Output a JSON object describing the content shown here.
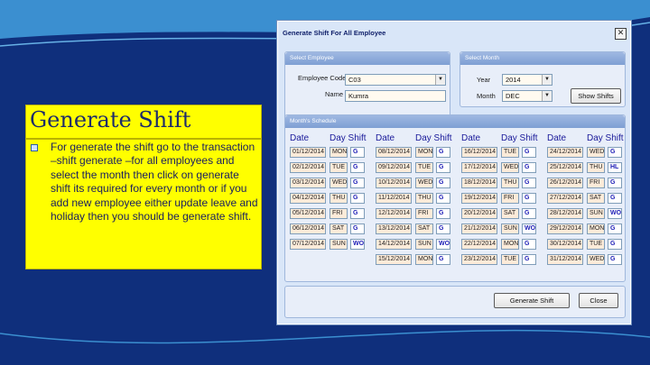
{
  "slide": {
    "title": "Generate Shift",
    "body": "For generate the shift go to the transaction –shift generate –for all employees and select the month then click on generate shift its required for every month or if you add new employee either update leave and holiday then you should be generate shift."
  },
  "dialog": {
    "title": "Generate Shift For All Employee",
    "select_employee": {
      "heading": "Select Employee",
      "code_label": "Employee Code",
      "code_value": "C03",
      "name_label": "Name",
      "name_value": "Kumra"
    },
    "select_month": {
      "heading": "Select Month",
      "year_label": "Year",
      "year_value": "2014",
      "month_label": "Month",
      "month_value": "DEC",
      "show_button": "Show Shifts"
    },
    "schedule": {
      "heading": "Month's Schedule",
      "date_header": "Date",
      "day_shift_header": "Day Shift",
      "columns": [
        [
          {
            "date": "01/12/2014",
            "day": "MON",
            "shift": "G"
          },
          {
            "date": "02/12/2014",
            "day": "TUE",
            "shift": "G"
          },
          {
            "date": "03/12/2014",
            "day": "WED",
            "shift": "G"
          },
          {
            "date": "04/12/2014",
            "day": "THU",
            "shift": "G"
          },
          {
            "date": "05/12/2014",
            "day": "FRI",
            "shift": "G"
          },
          {
            "date": "06/12/2014",
            "day": "SAT",
            "shift": "G"
          },
          {
            "date": "07/12/2014",
            "day": "SUN",
            "shift": "WO"
          }
        ],
        [
          {
            "date": "08/12/2014",
            "day": "MON",
            "shift": "G"
          },
          {
            "date": "09/12/2014",
            "day": "TUE",
            "shift": "G"
          },
          {
            "date": "10/12/2014",
            "day": "WED",
            "shift": "G"
          },
          {
            "date": "11/12/2014",
            "day": "THU",
            "shift": "G"
          },
          {
            "date": "12/12/2014",
            "day": "FRI",
            "shift": "G"
          },
          {
            "date": "13/12/2014",
            "day": "SAT",
            "shift": "G"
          },
          {
            "date": "14/12/2014",
            "day": "SUN",
            "shift": "WO"
          },
          {
            "date": "15/12/2014",
            "day": "MON",
            "shift": "G"
          }
        ],
        [
          {
            "date": "16/12/2014",
            "day": "TUE",
            "shift": "G"
          },
          {
            "date": "17/12/2014",
            "day": "WED",
            "shift": "G"
          },
          {
            "date": "18/12/2014",
            "day": "THU",
            "shift": "G"
          },
          {
            "date": "19/12/2014",
            "day": "FRI",
            "shift": "G"
          },
          {
            "date": "20/12/2014",
            "day": "SAT",
            "shift": "G"
          },
          {
            "date": "21/12/2014",
            "day": "SUN",
            "shift": "WO"
          },
          {
            "date": "22/12/2014",
            "day": "MON",
            "shift": "G"
          },
          {
            "date": "23/12/2014",
            "day": "TUE",
            "shift": "G"
          }
        ],
        [
          {
            "date": "24/12/2014",
            "day": "WED",
            "shift": "G"
          },
          {
            "date": "25/12/2014",
            "day": "THU",
            "shift": "HL"
          },
          {
            "date": "26/12/2014",
            "day": "FRI",
            "shift": "G"
          },
          {
            "date": "27/12/2014",
            "day": "SAT",
            "shift": "G"
          },
          {
            "date": "28/12/2014",
            "day": "SUN",
            "shift": "WO"
          },
          {
            "date": "29/12/2014",
            "day": "MON",
            "shift": "G"
          },
          {
            "date": "30/12/2014",
            "day": "TUE",
            "shift": "G"
          },
          {
            "date": "31/12/2014",
            "day": "WED",
            "shift": "G"
          }
        ]
      ]
    },
    "generate_button": "Generate Shift",
    "close_button": "Close"
  }
}
